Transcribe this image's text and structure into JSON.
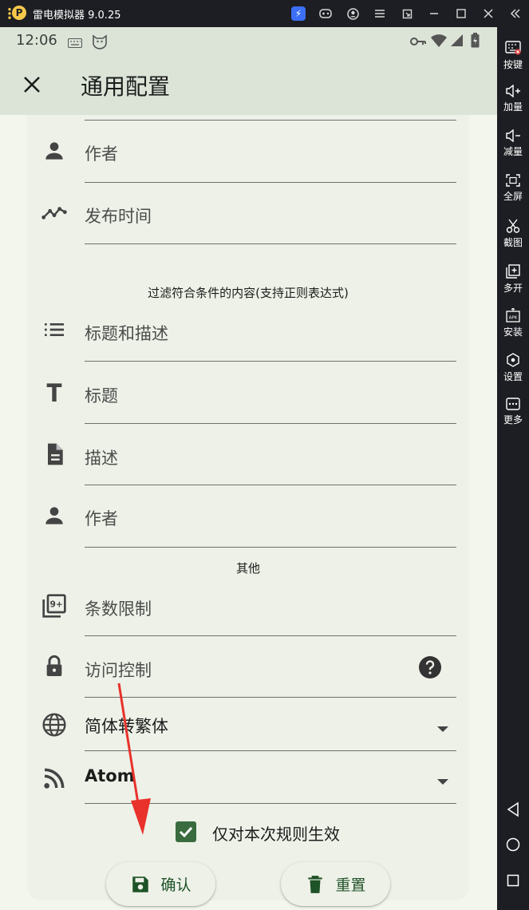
{
  "window": {
    "title": "雷电模拟器 9.0.25",
    "logo_text": "P"
  },
  "statusbar": {
    "time": "12:06"
  },
  "appbar": {
    "title": "通用配置"
  },
  "form": {
    "rows_top": [
      {
        "icon": "person-icon",
        "label": "作者"
      },
      {
        "icon": "trending-icon",
        "label": "发布时间"
      }
    ],
    "filter_section_title": "过滤符合条件的内容(支持正则表达式)",
    "filter_rows": [
      {
        "icon": "list-icon",
        "label": "标题和描述"
      },
      {
        "icon": "text-icon",
        "label": "标题"
      },
      {
        "icon": "document-icon",
        "label": "描述"
      },
      {
        "icon": "person-icon",
        "label": "作者"
      }
    ],
    "other_section_title": "其他",
    "limit_row": {
      "icon": "count-limit-icon",
      "label": "条数限制"
    },
    "access_row": {
      "icon": "lock-icon",
      "label": "访问控制",
      "help_icon": "help-icon"
    },
    "convert_select": {
      "icon": "globe-icon",
      "value": "简体转繁体"
    },
    "format_select": {
      "icon": "rss-icon",
      "value": "Atom"
    },
    "checkbox": {
      "label": "仅对本次规则生效",
      "checked": true
    },
    "confirm_button": {
      "icon": "save-icon",
      "label": "确认"
    },
    "reset_button": {
      "icon": "delete-icon",
      "label": "重置"
    }
  },
  "sidebar": {
    "items": [
      {
        "icon": "keyboard-icon",
        "label": "按键"
      },
      {
        "icon": "volume-up-icon",
        "label": "加量"
      },
      {
        "icon": "volume-down-icon",
        "label": "减量"
      },
      {
        "icon": "fullscreen-icon",
        "label": "全屏"
      },
      {
        "icon": "scissors-icon",
        "label": "截图"
      },
      {
        "icon": "multi-instance-icon",
        "label": "多开"
      },
      {
        "icon": "apk-install-icon",
        "label": "安装"
      },
      {
        "icon": "settings-icon",
        "label": "设置"
      },
      {
        "icon": "more-icon",
        "label": "更多"
      }
    ],
    "nav": [
      "back-icon",
      "home-icon",
      "recents-icon"
    ]
  },
  "colors": {
    "accent": "#3a6b3e",
    "button_text": "#1e5227",
    "appbar_bg": "#dce4d8",
    "screen_bg": "#f3f6ec",
    "annotation_arrow": "#e8322b"
  }
}
